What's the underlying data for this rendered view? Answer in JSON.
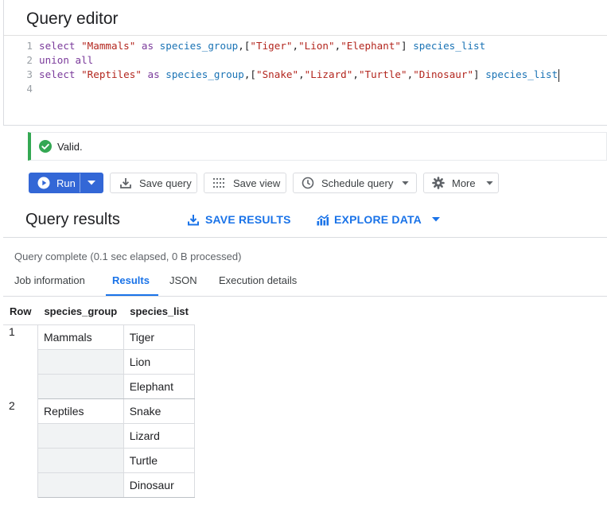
{
  "editor": {
    "title": "Query editor",
    "line_numbers": [
      "1",
      "2",
      "3",
      "4"
    ],
    "code_lines": [
      [
        {
          "t": "select ",
          "c": "kw"
        },
        {
          "t": "\"Mammals\"",
          "c": "str"
        },
        {
          "t": " as ",
          "c": "kw"
        },
        {
          "t": "species_group",
          "c": "id"
        },
        {
          "t": ",[",
          "c": "pn"
        },
        {
          "t": "\"Tiger\"",
          "c": "str"
        },
        {
          "t": ",",
          "c": "pn"
        },
        {
          "t": "\"Lion\"",
          "c": "str"
        },
        {
          "t": ",",
          "c": "pn"
        },
        {
          "t": "\"Elephant\"",
          "c": "str"
        },
        {
          "t": "] ",
          "c": "pn"
        },
        {
          "t": "species_list",
          "c": "id"
        }
      ],
      [
        {
          "t": "union all",
          "c": "kw"
        }
      ],
      [
        {
          "t": "select ",
          "c": "kw"
        },
        {
          "t": "\"Reptiles\"",
          "c": "str"
        },
        {
          "t": " as ",
          "c": "kw"
        },
        {
          "t": "species_group",
          "c": "id"
        },
        {
          "t": ",[",
          "c": "pn"
        },
        {
          "t": "\"Snake\"",
          "c": "str"
        },
        {
          "t": ",",
          "c": "pn"
        },
        {
          "t": "\"Lizard\"",
          "c": "str"
        },
        {
          "t": ",",
          "c": "pn"
        },
        {
          "t": "\"Turtle\"",
          "c": "str"
        },
        {
          "t": ",",
          "c": "pn"
        },
        {
          "t": "\"Dinosaur\"",
          "c": "str"
        },
        {
          "t": "] ",
          "c": "pn"
        },
        {
          "t": "species_list",
          "c": "id"
        }
      ],
      []
    ]
  },
  "validation": {
    "text": "Valid.",
    "status_color": "#34a853"
  },
  "toolbar": {
    "run_label": "Run",
    "save_query_label": "Save query",
    "save_view_label": "Save view",
    "schedule_label": "Schedule query",
    "more_label": "More"
  },
  "results": {
    "title": "Query results",
    "save_results_label": "SAVE RESULTS",
    "explore_data_label": "EXPLORE DATA",
    "status": "Query complete (0.1 sec elapsed, 0 B processed)",
    "tabs": [
      "Job information",
      "Results",
      "JSON",
      "Execution details"
    ],
    "active_tab": "Results",
    "table": {
      "headers": [
        "Row",
        "species_group",
        "species_list"
      ],
      "rows": [
        {
          "row": "1",
          "group": "Mammals",
          "items": [
            "Tiger",
            "Lion",
            "Elephant"
          ]
        },
        {
          "row": "2",
          "group": "Reptiles",
          "items": [
            "Snake",
            "Lizard",
            "Turtle",
            "Dinosaur"
          ]
        }
      ]
    }
  },
  "colors": {
    "accent": "#1a73e8",
    "run_button": "#3367d6",
    "valid": "#34a853"
  }
}
